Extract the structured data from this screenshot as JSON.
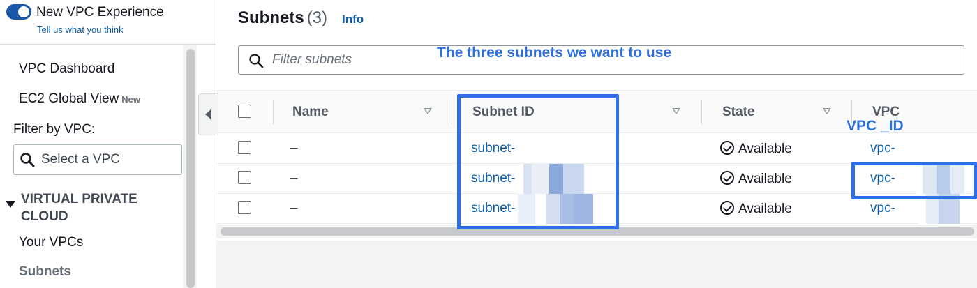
{
  "sidebar": {
    "experience_title": "New VPC Experience",
    "experience_feedback": "Tell us what you think",
    "nav": {
      "vpc_dashboard": "VPC Dashboard",
      "ec2_global_view": "EC2 Global View",
      "ec2_global_view_badge": "New",
      "your_vpcs": "Your VPCs",
      "subnets": "Subnets"
    },
    "filter_label": "Filter by VPC:",
    "vpc_select_placeholder": "Select a VPC",
    "section_title": "VIRTUAL PRIVATE CLOUD"
  },
  "main": {
    "title": "Subnets",
    "count": "(3)",
    "info_link": "Info",
    "filter_placeholder": "Filter subnets",
    "table": {
      "columns": [
        "Name",
        "Subnet ID",
        "State",
        "VPC"
      ],
      "rows": [
        {
          "name": "–",
          "subnet_id": "subnet-",
          "state": "Available",
          "vpc": "vpc-"
        },
        {
          "name": "–",
          "subnet_id": "subnet-",
          "state": "Available",
          "vpc": "vpc-"
        },
        {
          "name": "–",
          "subnet_id": "subnet-",
          "state": "Available",
          "vpc": "vpc-"
        }
      ]
    }
  },
  "annotations": {
    "top": "The three subnets we want to use",
    "vpc": "VPC _ID"
  },
  "colors": {
    "link": "#0f5ea8",
    "annotation": "#2f6fe8",
    "toggle": "#1a57a8"
  }
}
